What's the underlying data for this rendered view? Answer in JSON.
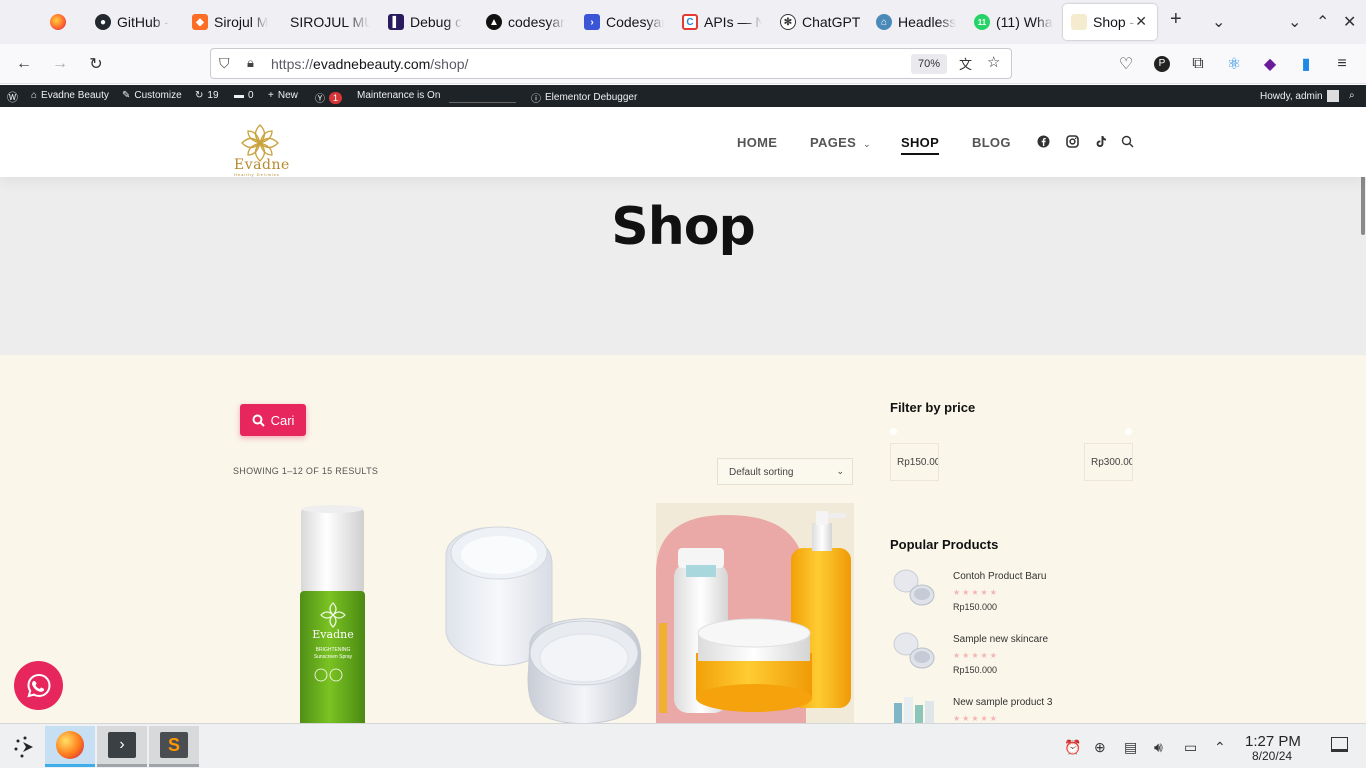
{
  "browser": {
    "tabs": [
      {
        "label": "",
        "favicon": "firefox-icon"
      },
      {
        "label": "GitHub -",
        "favicon": "github-icon"
      },
      {
        "label": "Sirojul M",
        "favicon": "gitlab-icon"
      },
      {
        "label": "SIROJUL MU",
        "favicon": "none"
      },
      {
        "label": "Debug c",
        "favicon": "debug-icon"
      },
      {
        "label": "codesyar",
        "favicon": "triangle-icon"
      },
      {
        "label": "Codesyar",
        "favicon": "codesyar-icon"
      },
      {
        "label": "APIs — N",
        "favicon": "apis-icon"
      },
      {
        "label": "ChatGPT",
        "favicon": "chatgpt-icon"
      },
      {
        "label": "Headless",
        "favicon": "headless-icon"
      },
      {
        "label": "(11) Wha",
        "favicon": "whatsapp-icon"
      },
      {
        "label": "Shop -",
        "favicon": "evadne-icon",
        "active": true
      }
    ],
    "url_prefix": "https://",
    "url_domain": "evadnebeauty.com",
    "url_path": "/shop/",
    "zoom": "70%"
  },
  "wp_admin_bar": {
    "site_name": "Evadne Beauty",
    "customize": "Customize",
    "updates": "19",
    "comments": "0",
    "new": "New",
    "yoast_badge": "1",
    "maintenance": "Maintenance is On",
    "debugger": "Elementor Debugger",
    "howdy": "Howdy, admin"
  },
  "site": {
    "logo_text": "Evadne",
    "logo_tagline": "Healthy Delimiss",
    "menu": [
      {
        "label": "HOME"
      },
      {
        "label": "PAGES"
      },
      {
        "label": "SHOP",
        "current": true
      },
      {
        "label": "BLOG"
      }
    ],
    "hero_title": "Shop",
    "search_button": "Cari",
    "results_count": "SHOWING 1–12 OF 15 RESULTS",
    "sort_value": "Default sorting",
    "products": [
      {
        "name": "Evadne Brightening Sunscreen Spray"
      },
      {
        "name": "Clear jar"
      },
      {
        "name": "Cosmetic set"
      }
    ],
    "sidebar": {
      "filter_title": "Filter by price",
      "price_min": "Rp150.000",
      "price_max": "Rp300.000",
      "popular_title": "Popular Products",
      "popular": [
        {
          "name": "Contoh Product Baru",
          "stars": "★★★★★",
          "price": "Rp150.000"
        },
        {
          "name": "Sample new skincare",
          "stars": "★★★★★",
          "price": "Rp150.000"
        },
        {
          "name": "New sample product 3",
          "stars": "★★★★★",
          "price": ""
        }
      ]
    },
    "colors": {
      "accent": "#e8265e",
      "background": "#faf6e9",
      "hero": "#ededee"
    }
  },
  "taskbar": {
    "time": "1:27 PM",
    "date": "8/20/24"
  }
}
